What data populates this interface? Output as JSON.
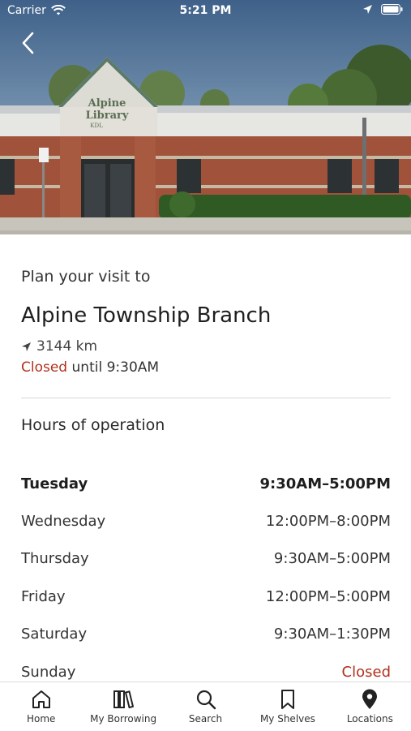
{
  "status_bar": {
    "carrier": "Carrier",
    "time": "5:21 PM"
  },
  "hero": {
    "sign_line1": "Alpine",
    "sign_line2": "Library",
    "sign_line3": "KDL"
  },
  "branch": {
    "intro": "Plan your visit to",
    "name": "Alpine Township Branch",
    "distance": "3144 km",
    "status_closed": "Closed",
    "status_until": "until 9:30AM"
  },
  "hours": {
    "title": "Hours of operation",
    "rows": [
      {
        "day": "Tuesday",
        "time": "9:30AM–5:00PM"
      },
      {
        "day": "Wednesday",
        "time": "12:00PM–8:00PM"
      },
      {
        "day": "Thursday",
        "time": "9:30AM–5:00PM"
      },
      {
        "day": "Friday",
        "time": "12:00PM–5:00PM"
      },
      {
        "day": "Saturday",
        "time": "9:30AM–1:30PM"
      },
      {
        "day": "Sunday",
        "time": "Closed"
      }
    ]
  },
  "tabs": [
    {
      "label": "Home",
      "icon": "home-icon"
    },
    {
      "label": "My Borrowing",
      "icon": "books-icon"
    },
    {
      "label": "Search",
      "icon": "search-icon"
    },
    {
      "label": "My Shelves",
      "icon": "bookmark-icon"
    },
    {
      "label": "Locations",
      "icon": "location-pin-icon"
    }
  ],
  "colors": {
    "closed": "#b2301c",
    "brick": "#a0523a",
    "sky": "#4a6f96"
  }
}
